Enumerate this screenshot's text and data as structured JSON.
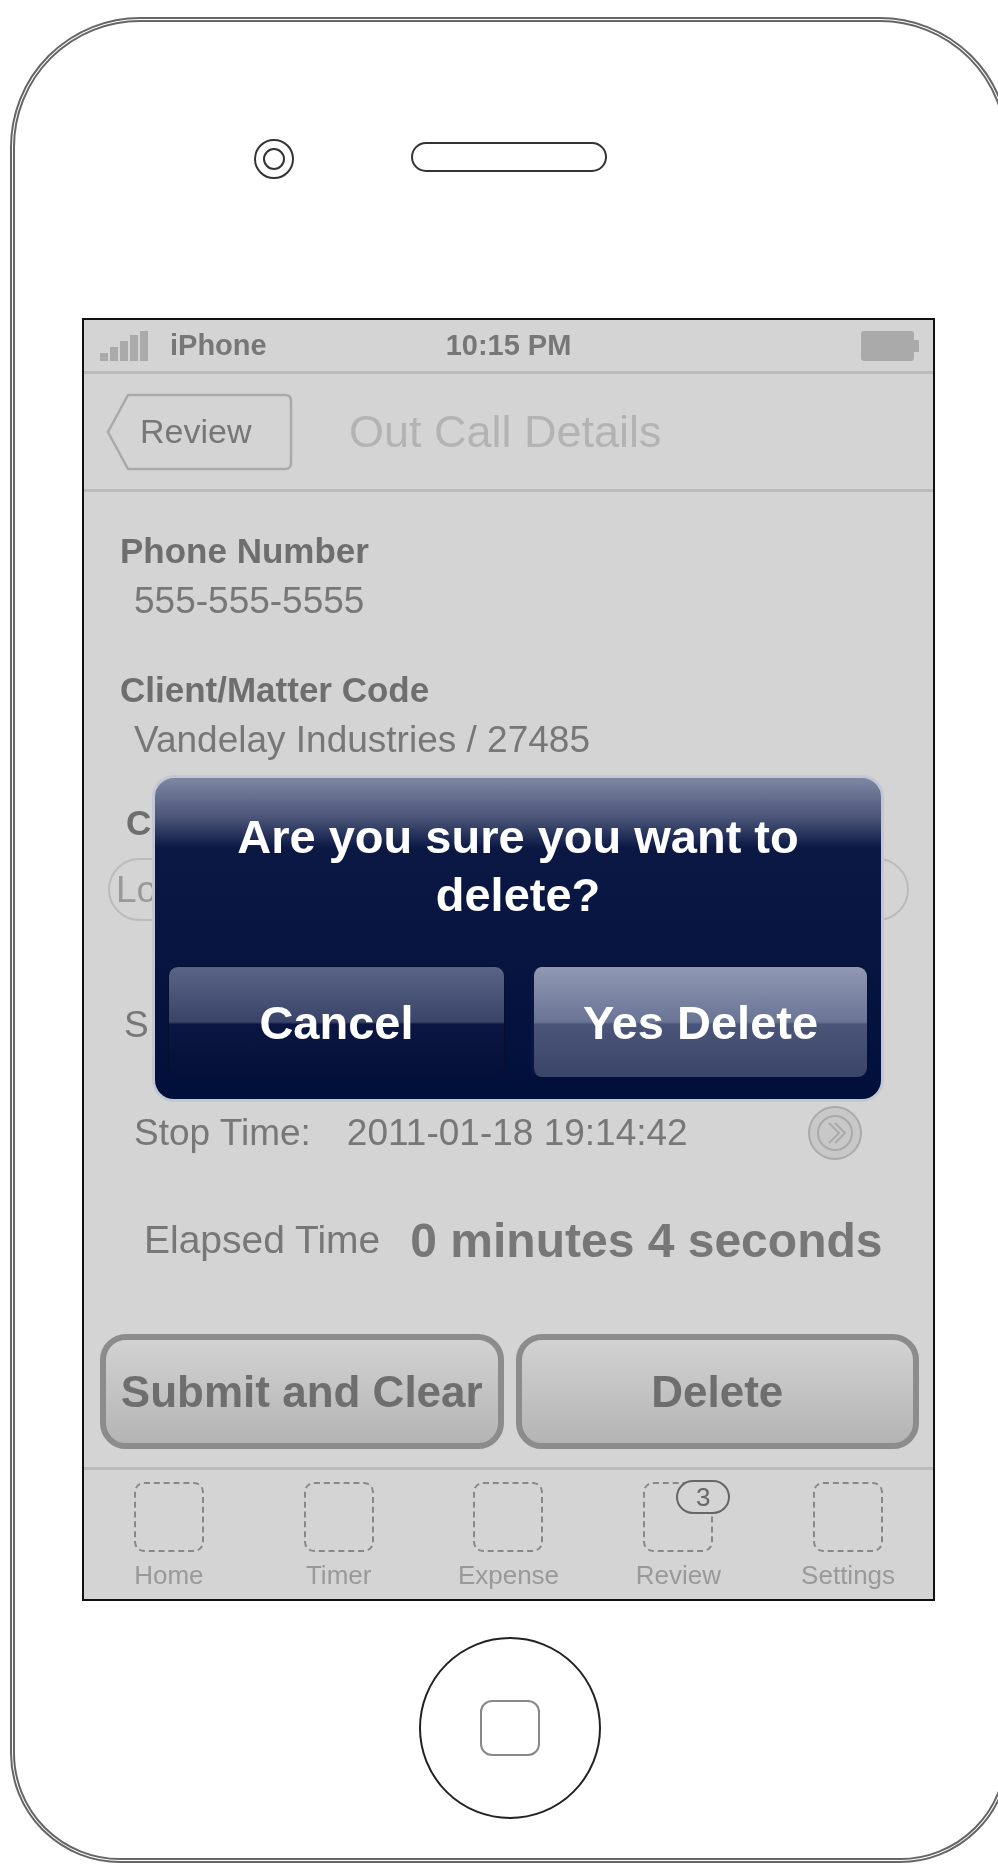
{
  "status_bar": {
    "carrier": "iPhone",
    "time": "10:15 PM"
  },
  "nav_bar": {
    "back_button": "Review",
    "title": "Out Call Details"
  },
  "fields": [
    {
      "label": "Phone Number",
      "value": "555-555-5555"
    },
    {
      "label": "Client/Matter Code",
      "value": "Vandelay Industries / 27485"
    }
  ],
  "partly_hidden": {
    "label": "C",
    "field_value": "Lo",
    "row_text": "S"
  },
  "stop_time": {
    "label": "Stop Time:",
    "value": "2011-01-18 19:14:42"
  },
  "elapsed": {
    "label": "Elapsed Time",
    "value": "0 minutes 4 seconds"
  },
  "buttons": [
    "Submit and Clear",
    "Delete"
  ],
  "tabs": [
    {
      "label": "Home",
      "selected": false
    },
    {
      "label": "Timer",
      "selected": false
    },
    {
      "label": "Expense",
      "selected": false
    },
    {
      "label": "Review",
      "selected": false,
      "badge": "3"
    },
    {
      "label": "Settings",
      "selected": false
    }
  ],
  "alert": {
    "message": "Are you sure you want to delete?",
    "buttons": [
      "Cancel",
      "Yes Delete"
    ]
  }
}
